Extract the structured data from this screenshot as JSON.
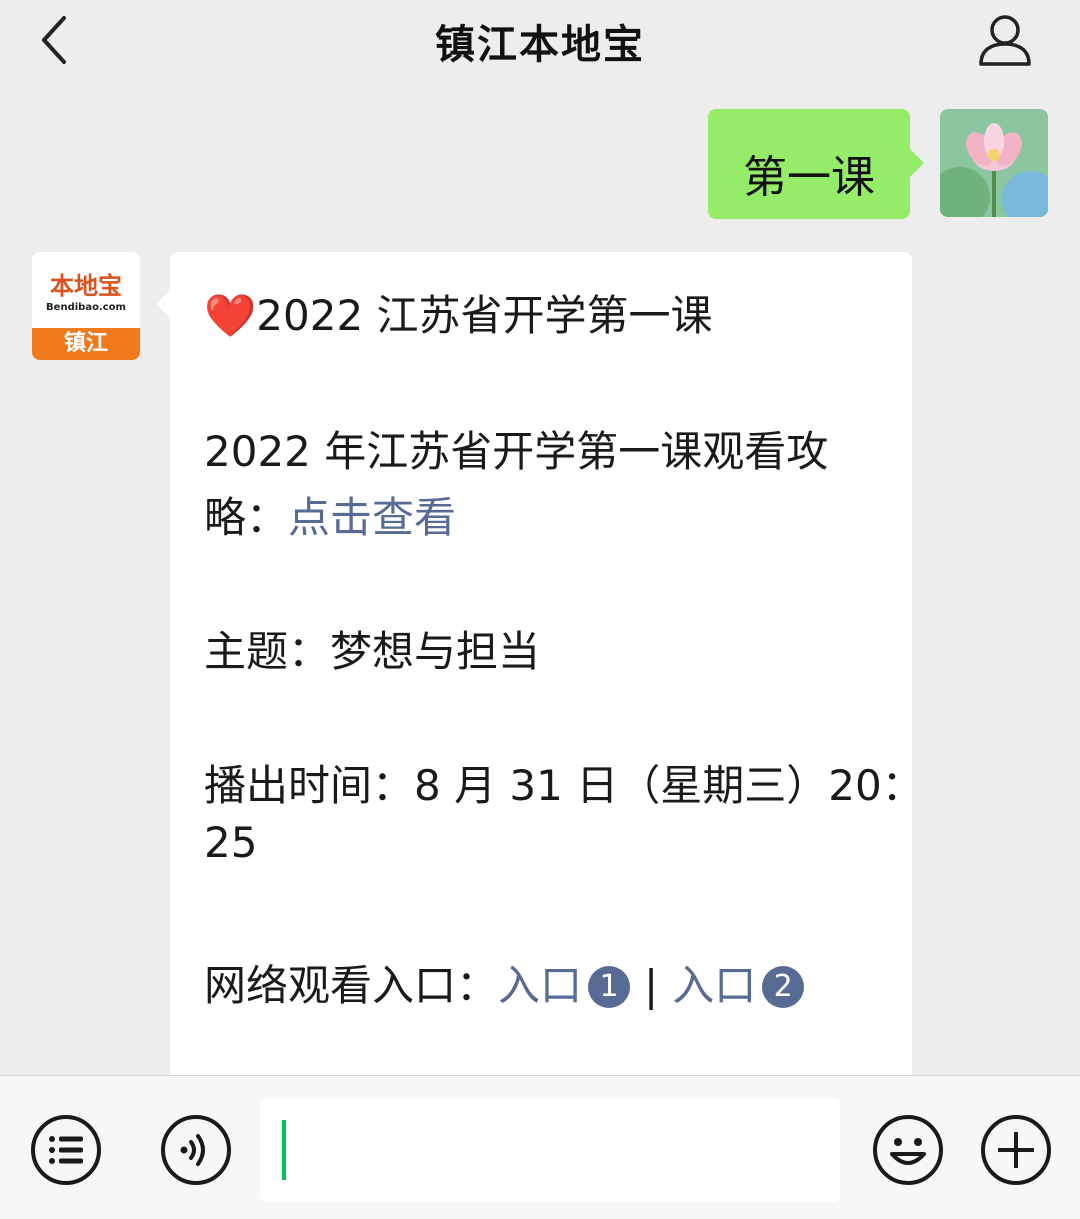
{
  "header": {
    "title": "镇江本地宝"
  },
  "messages": {
    "sent": {
      "text": "第一课"
    },
    "bot": {
      "avatar_brand": "本地宝",
      "avatar_domain": "Bendibao.com",
      "avatar_city": "镇江",
      "heading_emoji": "❤️",
      "heading": "2022 江苏省开学第一课",
      "guide_line1": "2022 年江苏省开学第一课观看攻",
      "guide_line2_prefix": "略：",
      "guide_link": "点击查看",
      "theme": "主题：梦想与担当",
      "time_line1": "播出时间：8 月 31 日（星期三）20：",
      "time_line2": "25",
      "entry_label": "网络观看入口：",
      "entry1_label": "入口",
      "entry1_num": "1",
      "separator": "|",
      "entry2_label": "入口",
      "entry2_num": "2"
    }
  },
  "colors": {
    "bubble_sent": "#95ec69",
    "link": "#576b95",
    "background": "#ededed",
    "cursor": "#07c160"
  },
  "icons": [
    "back-chevron-icon",
    "profile-icon",
    "menu-list-icon",
    "voice-icon",
    "emoji-icon",
    "plus-icon"
  ]
}
